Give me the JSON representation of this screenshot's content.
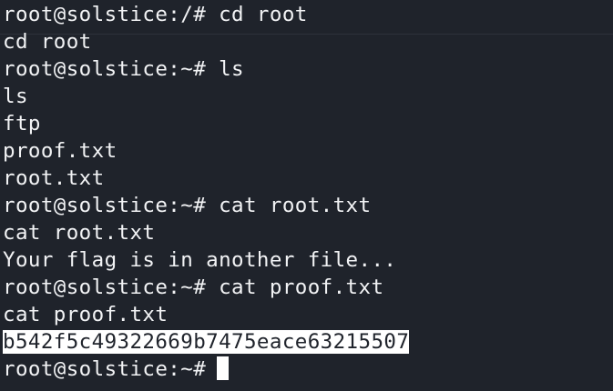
{
  "terminal": {
    "lines": [
      "root@solstice:/# cd root",
      "cd root",
      "root@solstice:~# ls",
      "ls",
      "ftp",
      "proof.txt",
      "root.txt",
      "root@solstice:~# cat root.txt",
      "cat root.txt",
      "Your flag is in another file...",
      "root@solstice:~# cat proof.txt",
      "cat proof.txt",
      "b542f5c49322669b7475eace63215507",
      "root@solstice:~#"
    ]
  },
  "colors": {
    "background": "#1f232b",
    "text": "#f2f3f5",
    "highlight_bg": "#ffffff",
    "highlight_text": "#1f232b",
    "cursor": "#ffffff"
  }
}
